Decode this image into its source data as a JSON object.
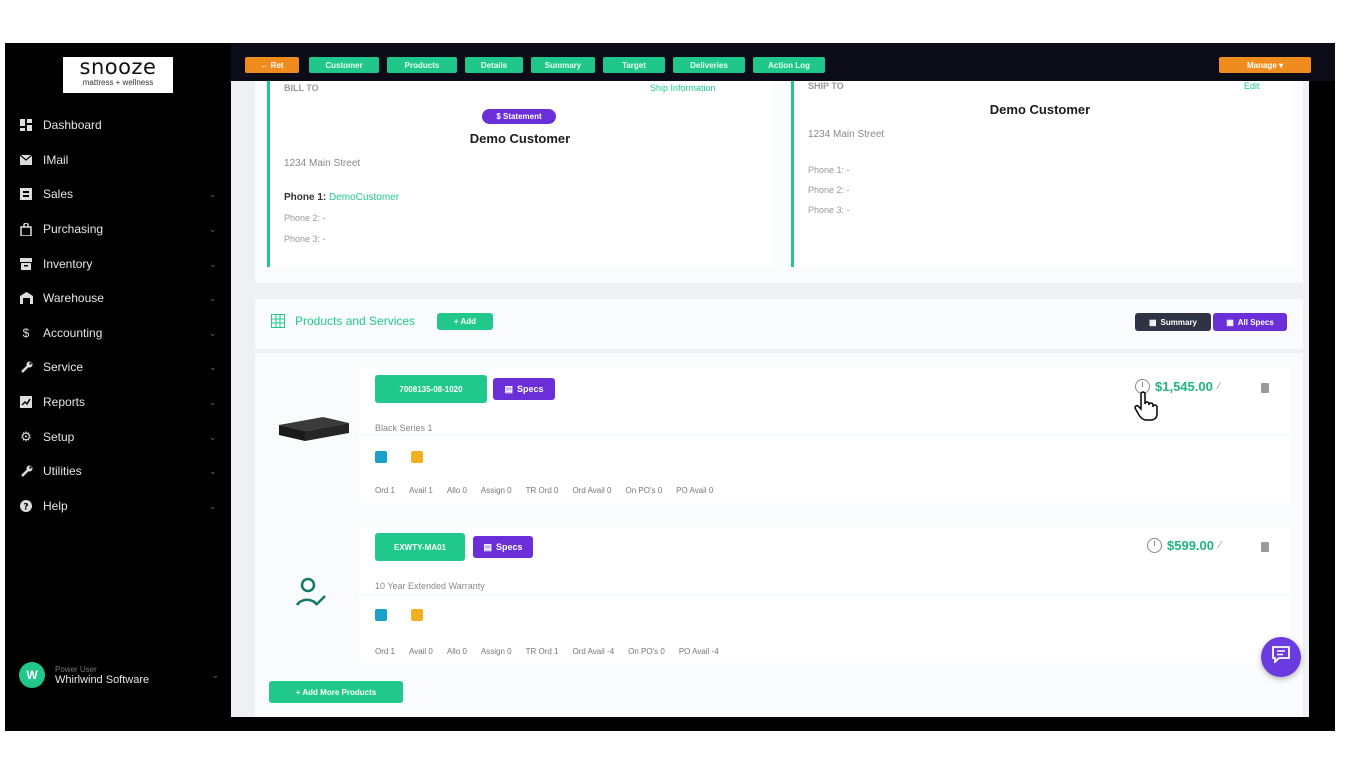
{
  "logo": {
    "word": "snooze",
    "tagline": "mattress + wellness"
  },
  "sidebar": {
    "items": [
      {
        "label": "Dashboard",
        "icon": "dashboard-icon",
        "chevron": false
      },
      {
        "label": "IMail",
        "icon": "mail-icon",
        "chevron": false
      },
      {
        "label": "Sales",
        "icon": "sales-icon",
        "chevron": true
      },
      {
        "label": "Purchasing",
        "icon": "bag-icon",
        "chevron": true
      },
      {
        "label": "Inventory",
        "icon": "inventory-icon",
        "chevron": true
      },
      {
        "label": "Warehouse",
        "icon": "warehouse-icon",
        "chevron": true
      },
      {
        "label": "Accounting",
        "icon": "dollar-icon",
        "chevron": true
      },
      {
        "label": "Service",
        "icon": "wrench-icon",
        "chevron": true
      },
      {
        "label": "Reports",
        "icon": "reports-icon",
        "chevron": true
      },
      {
        "label": "Setup",
        "icon": "gear-icon",
        "chevron": true
      },
      {
        "label": "Utilities",
        "icon": "wrench-icon",
        "chevron": true
      },
      {
        "label": "Help",
        "icon": "help-icon",
        "chevron": true
      }
    ],
    "user": {
      "initial": "W",
      "role": "Power User",
      "name": "Whirlwind Software"
    }
  },
  "topbar": {
    "back": "← Ret",
    "tabs": [
      "Customer",
      "Products",
      "Details",
      "Summary",
      "Target",
      "Deliveries",
      "Action Log"
    ],
    "manage": "Manage ▾"
  },
  "bill_to": {
    "header": "BILL TO",
    "header_link": "Ship Information",
    "statement_badge": "$ Statement",
    "name": "Demo Customer",
    "address": "1234 Main Street",
    "phone1_label": "Phone 1:",
    "phone1_value": "DemoCustomer",
    "phone2": "Phone 2: -",
    "phone3": "Phone 3: -"
  },
  "ship_to": {
    "header": "SHIP TO",
    "header_link": "Edit",
    "name": "Demo Customer",
    "address": "1234 Main Street",
    "phone1": "Phone 1: -",
    "phone2": "Phone 2: -",
    "phone3": "Phone 3: -"
  },
  "products_section": {
    "title": "Products and Services",
    "add_label": "+ Add",
    "summary_label": "Summary",
    "all_specs_label": "All Specs",
    "items": [
      {
        "sku": "7008135-08-1020",
        "specs_label": "Specs",
        "description": "Black Series 1",
        "price": "$1,545.00",
        "stats": [
          "Ord 1",
          "Avail 1",
          "Allo 0",
          "Assign 0",
          "TR Ord 0",
          "Ord Avail 0",
          "On PO's 0",
          "PO Avail 0"
        ]
      },
      {
        "sku": "EXWTY-MA01",
        "specs_label": "Specs",
        "description": "10 Year Extended Warranty",
        "price": "$599.00",
        "stats": [
          "Ord 1",
          "Avail 0",
          "Allo 0",
          "Assign 0",
          "TR Ord 1",
          "Ord Avail -4",
          "On PO's 0",
          "PO Avail -4"
        ]
      }
    ],
    "add_more_label": "+ Add More Products"
  },
  "colors": {
    "accent_green": "#20c98b",
    "purple": "#6a2fd8",
    "orange": "#f08c1e",
    "price_green": "#20b57d"
  }
}
